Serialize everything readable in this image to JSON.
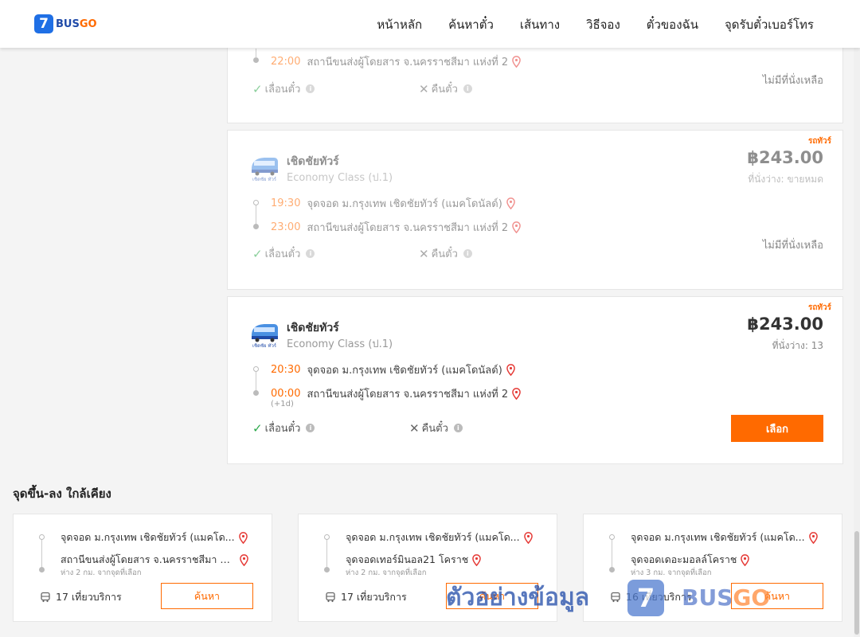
{
  "header": {
    "logo_digit": "7",
    "logo_bus": "BUS",
    "logo_go": "GO",
    "nav": [
      "หน้าหลัก",
      "ค้นหาตั๋ว",
      "เส้นทาง",
      "วิธีจอง",
      "ตั๋วของฉัน",
      "จุดรับตั๋วเบอร์โทร"
    ]
  },
  "trips": [
    {
      "arrive_time": "22:00",
      "arrive_place": "สถานีขนส่งผู้โดยสาร จ.นครราชสีมา แห่งที่ 2",
      "reschedule": "เลื่อนตั๋ว",
      "refund": "คืนตั๋ว",
      "status": "ไม่มีที่นั่งเหลือ"
    },
    {
      "tag": "รถทัวร์",
      "company": "เชิดชัยทัวร์",
      "bus_class": "Economy Class (ป.1)",
      "price": "฿243.00",
      "seats": "ที่นั่งว่าง: ขายหมด",
      "depart_time": "19:30",
      "depart_place": "จุดจอด ม.กรุงเทพ เชิดชัยทัวร์ (แมคโดนัลด์)",
      "arrive_time": "23:00",
      "arrive_place": "สถานีขนส่งผู้โดยสาร จ.นครราชสีมา แห่งที่ 2",
      "reschedule": "เลื่อนตั๋ว",
      "refund": "คืนตั๋ว",
      "status": "ไม่มีที่นั่งเหลือ"
    },
    {
      "tag": "รถทัวร์",
      "company": "เชิดชัยทัวร์",
      "bus_class": "Economy Class (ป.1)",
      "price": "฿243.00",
      "seats": "ที่นั่งว่าง: 13",
      "depart_time": "20:30",
      "depart_place": "จุดจอด ม.กรุงเทพ เชิดชัยทัวร์ (แมคโดนัลด์)",
      "arrive_time": "00:00",
      "arrive_place": "สถานีขนส่งผู้โดยสาร จ.นครราชสีมา แห่งที่ 2",
      "next_day": "(+1d)",
      "reschedule": "เลื่อนตั๋ว",
      "refund": "คืนตั๋ว",
      "button": "เลือก"
    }
  ],
  "nearby": {
    "title": "จุดขึ้น-ลง ใกล้เคียง",
    "cards": [
      {
        "from": "จุดจอด ม.กรุงเทพ เชิดชัยทัวร์ (แมคโด...",
        "to": "สถานีขนส่งผู้โดยสาร จ.นครราชสีมา แ...",
        "distance": "ห่าง 2 กม. จากจุดที่เลือก",
        "trips": "17 เที่ยวบริการ",
        "button": "ค้นหา"
      },
      {
        "from": "จุดจอด ม.กรุงเทพ เชิดชัยทัวร์ (แมคโด...",
        "to": "จุดจอดเทอร์มินอล21 โคราช",
        "distance": "ห่าง 2 กม. จากจุดที่เลือก",
        "trips": "17 เที่ยวบริการ",
        "button": "ค้นหา"
      },
      {
        "from": "จุดจอด ม.กรุงเทพ เชิดชัยทัวร์ (แมคโด...",
        "to": "จุดจอดเดอะมอลล์โคราช",
        "distance": "ห่าง 3 กม. จากจุดที่เลือก",
        "trips": "16 เที่ยวบริการ",
        "button": "ค้นหา"
      }
    ]
  },
  "watermark": {
    "text": "ตัวอย่างข้อมูล",
    "digit": "7",
    "bus": "BUS",
    "go": "GO"
  },
  "colors": {
    "accent": "#ff6a00",
    "brand_blue": "#1f6fe5",
    "check_green": "#2ba84a",
    "pin_red": "#e53935"
  }
}
